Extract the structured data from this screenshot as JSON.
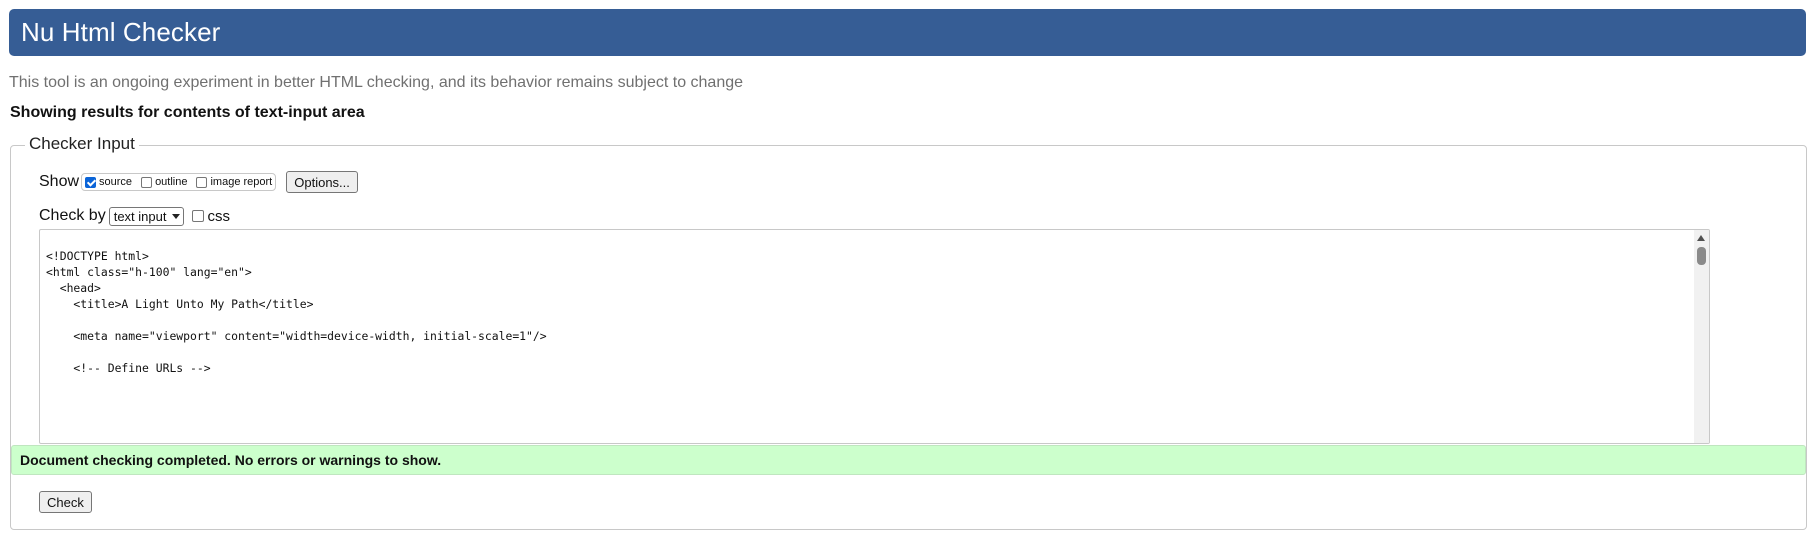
{
  "header": {
    "title": "Nu Html Checker"
  },
  "tagline": "This tool is an ongoing experiment in better HTML checking, and its behavior remains subject to change",
  "results_heading": "Showing results for contents of text-input area",
  "checker_input": {
    "legend": "Checker Input",
    "show": {
      "label": "Show",
      "options": [
        {
          "label": "source",
          "checked": true
        },
        {
          "label": "outline",
          "checked": false
        },
        {
          "label": "image report",
          "checked": false
        }
      ],
      "options_button": "Options..."
    },
    "check_by": {
      "label": "Check by",
      "selected": "text input",
      "css_label": "css",
      "css_checked": false
    },
    "source_lines": [
      "<!DOCTYPE html>",
      "<html class=\"h-100\" lang=\"en\">",
      "  <head>",
      "    <title>A Light Unto My Path</title>",
      "",
      "    <meta name=\"viewport\" content=\"width=device-width, initial-scale=1\"/>",
      "",
      "    <!-- Define URLs -->"
    ],
    "check_button": "Check"
  },
  "status": {
    "message": "Document checking completed. No errors or warnings to show.",
    "background": "#ccffcc"
  },
  "colors": {
    "header_bg": "#365d95",
    "tagline": "#707070"
  }
}
